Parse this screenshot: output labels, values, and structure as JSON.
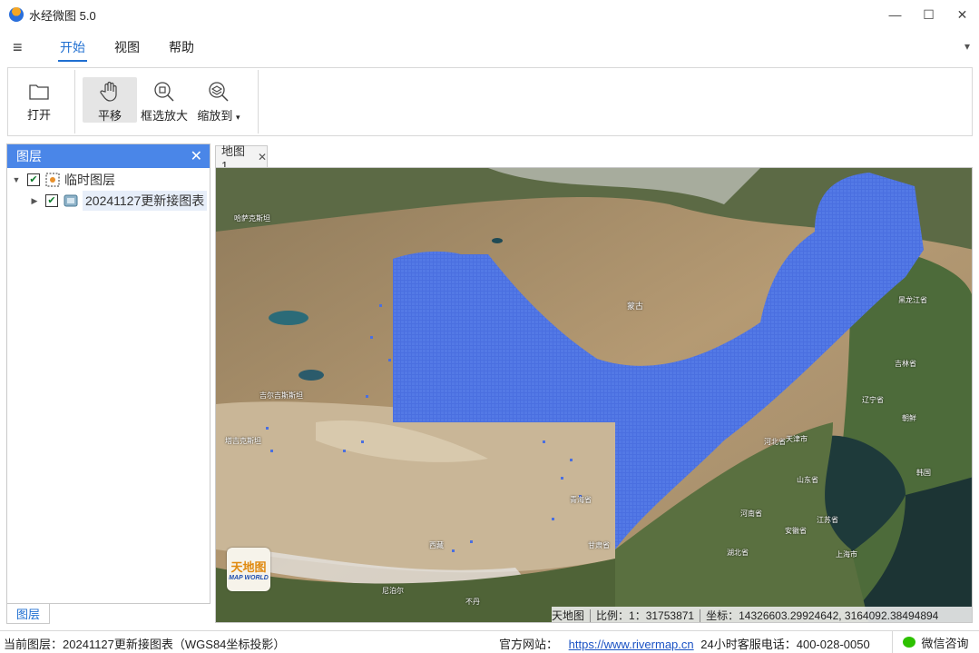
{
  "app": {
    "title": "水经微图 5.0"
  },
  "window_controls": {
    "minimize": "—",
    "maximize": "☐",
    "close": "✕"
  },
  "menu": {
    "items": [
      {
        "label": "开始",
        "active": true
      },
      {
        "label": "视图",
        "active": false
      },
      {
        "label": "帮助",
        "active": false
      }
    ]
  },
  "ribbon": {
    "open": "打开",
    "pan": "平移",
    "zoom_box": "框选放大",
    "zoom_to": "缩放到",
    "zoom_to_arrow": "▾"
  },
  "layer_panel": {
    "title": "图层",
    "close": "✕",
    "tab_label": "图层",
    "items": [
      {
        "label": "临时图层",
        "checked": true,
        "expanded": true,
        "icon": "temp-layer-icon"
      },
      {
        "label": "20241127更新接图表",
        "checked": true,
        "expanded": false,
        "icon": "raster-layer-icon"
      }
    ]
  },
  "map": {
    "tab_label": "地图 1",
    "tab_close": "✕",
    "logo_cn": "天地图",
    "logo_en": "MAP WORLD",
    "status": {
      "source": "天地图",
      "scale_label": "比例：",
      "scale_value": "1：31753871",
      "coord_label": "坐标：",
      "coord_value": "14326603.29924642, 3164092.38494894"
    },
    "labels": [
      "蒙古",
      "黑龙江省",
      "吉林省",
      "辽宁省",
      "朝鲜",
      "韩国",
      "天津市",
      "河北省",
      "山东省",
      "河南省",
      "安徽省",
      "江苏省",
      "湖北省",
      "上海市",
      "西藏",
      "青海省",
      "甘肃省",
      "尼泊尔",
      "不丹",
      "哈萨克斯坦",
      "吉尔吉斯斯坦",
      "塔吉克斯坦"
    ],
    "colors": {
      "grid_blue": "#4a6fe0",
      "land_tan": "#b59a73",
      "green": "#4d6b3a",
      "sea": "#1e3a3a"
    }
  },
  "statusbar": {
    "current_layer_label": "当前图层：",
    "current_layer_value": "20241127更新接图表（WGS84坐标投影）",
    "site_label": "官方网站：",
    "site_url": "https://www.rivermap.cn",
    "hotline_label": "24小时客服电话：",
    "hotline_value": "400-028-0050",
    "wechat": "微信咨询"
  }
}
